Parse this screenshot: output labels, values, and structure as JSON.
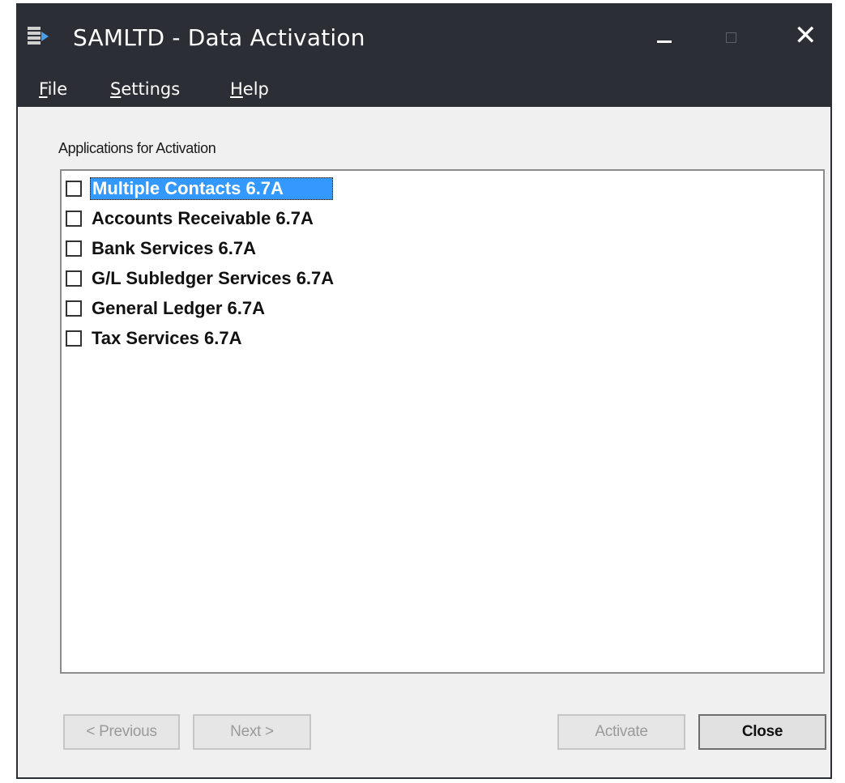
{
  "window": {
    "title": "SAMLTD - Data Activation",
    "close_glyph": "✕",
    "icon": "app-document-icon",
    "titlebar_color": "#2b2f35"
  },
  "menu": {
    "items": [
      "File",
      "Settings",
      "Help"
    ]
  },
  "group_label": "Applications for Activation",
  "applications": [
    {
      "label": "Multiple Contacts 6.7A",
      "checked": false,
      "selected": true
    },
    {
      "label": "Accounts Receivable 6.7A",
      "checked": false,
      "selected": false
    },
    {
      "label": "Bank Services 6.7A",
      "checked": false,
      "selected": false
    },
    {
      "label": "G/L Subledger Services 6.7A",
      "checked": false,
      "selected": false
    },
    {
      "label": "General Ledger 6.7A",
      "checked": false,
      "selected": false
    },
    {
      "label": "Tax Services 6.7A",
      "checked": false,
      "selected": false
    }
  ],
  "buttons": {
    "previous": "< Previous",
    "next": "Next >",
    "activate": "Activate",
    "close": "Close"
  },
  "selection_color": "#3399ff"
}
